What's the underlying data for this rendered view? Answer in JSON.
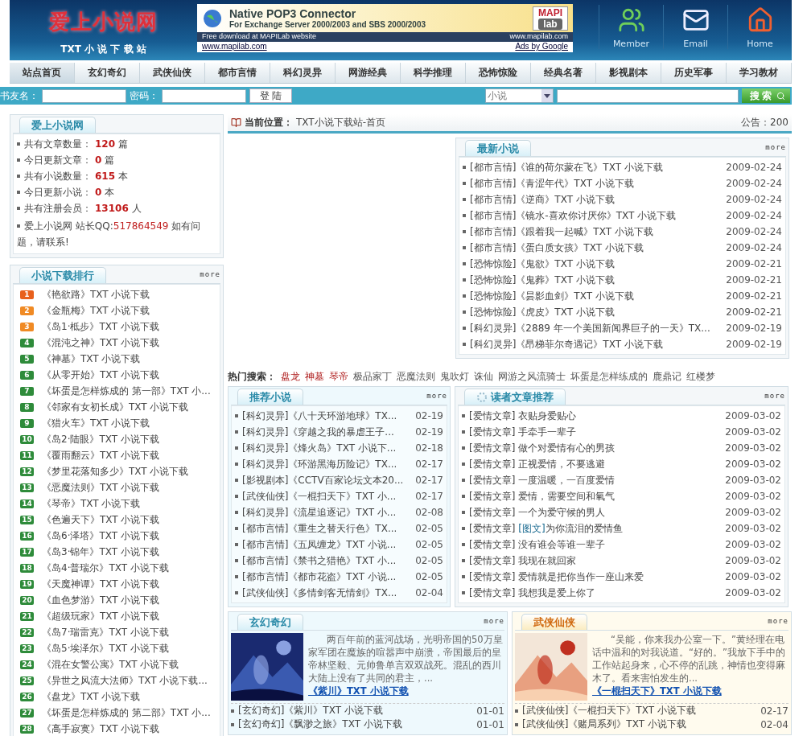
{
  "header": {
    "logo": "爱上小说网",
    "tagline": "TXT 小 说 下 载 站",
    "ad": {
      "title": "Native POP3 Connector",
      "subtitle": "For Exchange Server 2000/2003 and SBS 2000/2003",
      "brand_top": "MAPI",
      "brand_bottom": "lab",
      "strip_left": "Free download at MAPILab website",
      "strip_right": "www.mapilab.com",
      "link": "www.mapilab.com",
      "ads_by": "Ads by Google"
    },
    "shortcuts": [
      {
        "kind": "member",
        "label": "Member"
      },
      {
        "kind": "email",
        "label": "Email"
      },
      {
        "kind": "home",
        "label": "Home"
      }
    ]
  },
  "nav": [
    {
      "label": "站点首页",
      "selected": true
    },
    {
      "label": "玄幻奇幻",
      "selected": false
    },
    {
      "label": "武侠仙侠",
      "selected": false
    },
    {
      "label": "都市言情",
      "selected": false
    },
    {
      "label": "科幻灵异",
      "selected": false
    },
    {
      "label": "网游经典",
      "selected": false
    },
    {
      "label": "科学推理",
      "selected": false
    },
    {
      "label": "恐怖惊险",
      "selected": false
    },
    {
      "label": "经典名著",
      "selected": false
    },
    {
      "label": "影视剧本",
      "selected": false
    },
    {
      "label": "历史军事",
      "selected": false
    },
    {
      "label": "学习教材",
      "selected": false
    }
  ],
  "login": {
    "user_label": "书友名：",
    "password_label": "密码：",
    "login_button": "登 陆",
    "search_scope": "小说",
    "search_button": "搜 索"
  },
  "site_box": {
    "title": "爱上小说网",
    "stats": [
      {
        "label": "共有文章数量：",
        "value": "120",
        "unit": "篇"
      },
      {
        "label": "今日更新文章：",
        "value": "0",
        "unit": "篇"
      },
      {
        "label": "共有小说数量：",
        "value": "615",
        "unit": "本"
      },
      {
        "label": "今日更新小说：",
        "value": "0",
        "unit": "本"
      },
      {
        "label": "共有注册会员：",
        "value": "13106",
        "unit": "人"
      }
    ],
    "note": {
      "before": "爱上小说网 站长QQ:",
      "qq": "517864549",
      "after": " 如有问题，请联系!"
    }
  },
  "ranking": {
    "title": "小说下载排行",
    "more": "more",
    "items": [
      {
        "rank": "1",
        "color": "#e8601c",
        "title": "《艳欲路》TXT 小说下载"
      },
      {
        "rank": "2",
        "color": "#f08a24",
        "title": "《金瓶梅》TXT 小说下载"
      },
      {
        "rank": "3",
        "color": "#f08a24",
        "title": "《岛1·柢步》TXT 小说下载"
      },
      {
        "rank": "4",
        "color": "#2e8b3a",
        "title": "《混沌之神》TXT 小说下载"
      },
      {
        "rank": "5",
        "color": "#2e8b3a",
        "title": "《神墓》TXT 小说下载"
      },
      {
        "rank": "6",
        "color": "#2e8b3a",
        "title": "《从零开始》TXT 小说下载"
      },
      {
        "rank": "7",
        "color": "#2e8b3a",
        "title": "《坏蛋是怎样炼成的 第一部》TXT 小..."
      },
      {
        "rank": "8",
        "color": "#2e8b3a",
        "title": "《邻家有女初长成》TXT 小说下载"
      },
      {
        "rank": "9",
        "color": "#2e8b3a",
        "title": "《猎火车》TXT 小说下载"
      },
      {
        "rank": "10",
        "color": "#2e8b3a",
        "title": "《岛2·陆眼》TXT 小说下载"
      },
      {
        "rank": "11",
        "color": "#2e8b3a",
        "title": "《覆雨翻云》TXT 小说下载"
      },
      {
        "rank": "12",
        "color": "#2e8b3a",
        "title": "《梦里花落知多少》TXT 小说下载"
      },
      {
        "rank": "13",
        "color": "#2e8b3a",
        "title": "《恶魔法则》TXT 小说下载"
      },
      {
        "rank": "14",
        "color": "#2e8b3a",
        "title": "《琴帝》TXT 小说下载"
      },
      {
        "rank": "15",
        "color": "#2e8b3a",
        "title": "《色遍天下》TXT 小说下载"
      },
      {
        "rank": "16",
        "color": "#2e8b3a",
        "title": "《岛6·泽塔》TXT 小说下载"
      },
      {
        "rank": "17",
        "color": "#2e8b3a",
        "title": "《岛3·锦年》TXT 小说下载"
      },
      {
        "rank": "18",
        "color": "#2e8b3a",
        "title": "《岛4·普瑞尔》TXT 小说下载"
      },
      {
        "rank": "19",
        "color": "#2e8b3a",
        "title": "《天魔神谭》TXT 小说下载"
      },
      {
        "rank": "20",
        "color": "#2e8b3a",
        "title": "《血色梦游》TXT 小说下载"
      },
      {
        "rank": "21",
        "color": "#2e8b3a",
        "title": "《超级玩家》TXT 小说下载"
      },
      {
        "rank": "22",
        "color": "#2e8b3a",
        "title": "《岛7·瑞雷克》TXT 小说下载"
      },
      {
        "rank": "23",
        "color": "#2e8b3a",
        "title": "《岛5·埃泽尔》TXT 小说下载"
      },
      {
        "rank": "24",
        "color": "#2e8b3a",
        "title": "《混在女警公寓》TXT 小说下载"
      },
      {
        "rank": "25",
        "color": "#2e8b3a",
        "title": "《异世之风流大法师》TXT 小说下载..."
      },
      {
        "rank": "26",
        "color": "#2e8b3a",
        "title": "《盘龙》TXT 小说下载"
      },
      {
        "rank": "27",
        "color": "#2e8b3a",
        "title": "《坏蛋是怎样炼成的 第二部》TXT 小..."
      },
      {
        "rank": "28",
        "color": "#2e8b3a",
        "title": "《高手寂寞》TXT 小说下载"
      }
    ]
  },
  "breadcrumb": {
    "label": "当前位置：",
    "path": "TXT小说下载站-首页",
    "notice": "公告：200"
  },
  "newest": {
    "title": "最新小说",
    "more": "more",
    "items": [
      {
        "title": "[都市言情]《谁的荷尔蒙在飞》TXT 小说下载",
        "date": "2009-02-24"
      },
      {
        "title": "[都市言情]《青涩年代》TXT 小说下载",
        "date": "2009-02-24"
      },
      {
        "title": "[都市言情]《逆商》TXT 小说下载",
        "date": "2009-02-24"
      },
      {
        "title": "[都市言情]《镜水-喜欢你讨厌你》TXT 小说下载",
        "date": "2009-02-24"
      },
      {
        "title": "[都市言情]《跟着我一起喊》TXT 小说下载",
        "date": "2009-02-24"
      },
      {
        "title": "[都市言情]《蛋白质女孩》TXT 小说下载",
        "date": "2009-02-24"
      },
      {
        "title": "[恐怖惊险]《鬼欲》TXT 小说下载",
        "date": "2009-02-21"
      },
      {
        "title": "[恐怖惊险]《鬼葬》TXT 小说下载",
        "date": "2009-02-21"
      },
      {
        "title": "[恐怖惊险]《昙影血剑》TXT 小说下载",
        "date": "2009-02-21"
      },
      {
        "title": "[恐怖惊险]《虎皮》TXT 小说下载",
        "date": "2009-02-21"
      },
      {
        "title": "[科幻灵异]《2889 年一个美国新闻界巨子的一天》TX...",
        "date": "2009-02-19"
      },
      {
        "title": "[科幻灵异]《昂梯菲尔奇遇记》TXT 小说下载",
        "date": "2009-02-19"
      }
    ]
  },
  "hot_search": {
    "label": "热门搜索：",
    "terms": [
      {
        "text": "盘龙",
        "hot": true
      },
      {
        "text": "神墓",
        "hot": true
      },
      {
        "text": "琴帝",
        "hot": true
      },
      {
        "text": "极品家丁",
        "hot": false
      },
      {
        "text": "恶魔法则",
        "hot": false
      },
      {
        "text": "鬼吹灯",
        "hot": false
      },
      {
        "text": "诛仙",
        "hot": false
      },
      {
        "text": "网游之风流骑士",
        "hot": false
      },
      {
        "text": "坏蛋是怎样练成的",
        "hot": false
      },
      {
        "text": "鹿鼎记",
        "hot": false
      },
      {
        "text": "红楼梦",
        "hot": false
      }
    ]
  },
  "recommended": {
    "title": "推荐小说",
    "more": "more",
    "items": [
      {
        "title": "[科幻灵异]《八十天环游地球》TX...",
        "date": "02-19"
      },
      {
        "title": "[科幻灵异]《穿越之我的暴虐王子...",
        "date": "02-19"
      },
      {
        "title": "[科幻灵异]《烽火岛》TXT 小说下...",
        "date": "02-18"
      },
      {
        "title": "[科幻灵异]《环游黑海历险记》TX...",
        "date": "02-17"
      },
      {
        "title": "[影视剧本]《CCTV百家论坛文本20...",
        "date": "02-17"
      },
      {
        "title": "[武侠仙侠]《一棍扫天下》TXT 小...",
        "date": "02-17"
      },
      {
        "title": "[科幻灵异]《流星追逐记》TXT 小...",
        "date": "02-08"
      },
      {
        "title": "[都市言情]《重生之替天行色》TX...",
        "date": "02-05"
      },
      {
        "title": "[都市言情]《五凤缠龙》TXT 小说...",
        "date": "02-05"
      },
      {
        "title": "[都市言情]《禁书之猎艳》TXT 小...",
        "date": "02-05"
      },
      {
        "title": "[都市言情]《都市花盗》TXT 小说...",
        "date": "02-05"
      },
      {
        "title": "[武侠仙侠]《多情剑客无情剑》TX...",
        "date": "02-04"
      }
    ]
  },
  "reader": {
    "title": "读者文章推荐",
    "more": "more",
    "items": [
      {
        "category": "[爱情文章]",
        "title": "衣贴身爱贴心",
        "date": "2009-03-02"
      },
      {
        "category": "[爱情文章]",
        "title": "手牵手一辈子",
        "date": "2009-03-02"
      },
      {
        "category": "[爱情文章]",
        "title": "做个对爱情有心的男孩",
        "date": "2009-03-02"
      },
      {
        "category": "[爱情文章]",
        "title": "正视爱情，不要逃避",
        "date": "2009-03-02"
      },
      {
        "category": "[爱情文章]",
        "title": "一度温暖，一百度爱情",
        "date": "2009-03-02"
      },
      {
        "category": "[爱情文章]",
        "title": "爱情，需要空间和氧气",
        "date": "2009-03-02"
      },
      {
        "category": "[爱情文章]",
        "title": "一个为爱守候的男人",
        "date": "2009-03-02"
      },
      {
        "category": "[爱情文章]",
        "tag": "[图文]",
        "title": "为你流泪的爱情鱼",
        "date": "2009-03-02"
      },
      {
        "category": "[爱情文章]",
        "title": "没有谁会等谁一辈子",
        "date": "2009-03-02"
      },
      {
        "category": "[爱情文章]",
        "title": "我现在就回家",
        "date": "2009-03-02"
      },
      {
        "category": "[爱情文章]",
        "title": "爱情就是把你当作一座山来爱",
        "date": "2009-03-02"
      },
      {
        "category": "[爱情文章]",
        "title": "我想我是爱上你了",
        "date": "2009-03-02"
      }
    ]
  },
  "genre_boxes": [
    {
      "kind": "blue",
      "title": "玄幻奇幻",
      "more": "more",
      "cover": {
        "kind": "picture"
      },
      "summary": "两百年前的蓝河战场，光明帝国的50万皇家军团在魔族的喧嚣声中崩溃，帝国最后的皇帝林坚毅、元帅鲁单言双双战死。混乱的西川大陆上没有了共同的君主，...",
      "link": "《紫川》TXT 小说下载",
      "items": [
        {
          "title": "[玄幻奇幻]《紫川》TXT 小说下载",
          "date": "01-01"
        },
        {
          "title": "[玄幻奇幻]《飘渺之旅》TXT 小说下载",
          "date": "01-01"
        }
      ]
    },
    {
      "kind": "gold",
      "title": "武侠仙侠",
      "more": "more",
      "cover": {
        "kind": "picture"
      },
      "summary": "“吴能，你来我办公室一下。”黄经理在电话中温和的对我说道。“好的。”我放下手中的工作站起身来，心不停的乱跳，神情也变得麻木了。看来害怕发生的...",
      "link": "《一棍扫天下》TXT 小说下载",
      "items": [
        {
          "title": "[武侠仙侠]《一棍扫天下》TXT 小说下载",
          "date": "02-17"
        },
        {
          "title": "[武侠仙侠]《赌局系列》TXT 小说下载",
          "date": "02-04"
        }
      ]
    }
  ]
}
